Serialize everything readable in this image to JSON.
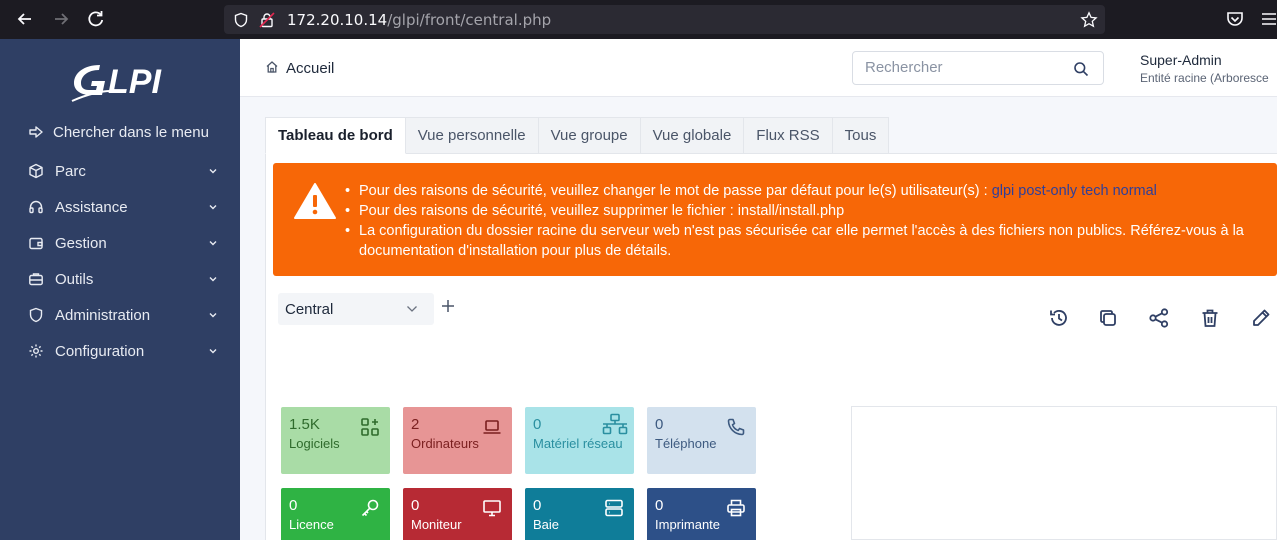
{
  "browser": {
    "url_host": "172.20.10.14",
    "url_path": "/glpi/front/central.php"
  },
  "sidebar": {
    "logo_text": "GLPI",
    "items": [
      {
        "label": "Chercher dans le menu",
        "icon": "arrow-right-icon"
      },
      {
        "label": "Parc",
        "icon": "cube-icon"
      },
      {
        "label": "Assistance",
        "icon": "headset-icon"
      },
      {
        "label": "Gestion",
        "icon": "wallet-icon"
      },
      {
        "label": "Outils",
        "icon": "briefcase-icon"
      },
      {
        "label": "Administration",
        "icon": "shield-icon"
      },
      {
        "label": "Configuration",
        "icon": "gear-icon"
      }
    ]
  },
  "header": {
    "breadcrumb": "Accueil",
    "search_placeholder": "Rechercher",
    "user_name": "Super-Admin",
    "user_entity": "Entité racine (Arboresce"
  },
  "tabs": [
    {
      "label": "Tableau de bord",
      "active": true
    },
    {
      "label": "Vue personnelle",
      "active": false
    },
    {
      "label": "Vue groupe",
      "active": false
    },
    {
      "label": "Vue globale",
      "active": false
    },
    {
      "label": "Flux RSS",
      "active": false
    },
    {
      "label": "Tous",
      "active": false
    }
  ],
  "alert": {
    "color": "#f76707",
    "line1_text": "Pour des raisons de sécurité, veuillez changer le mot de passe par défaut pour le(s) utilisateur(s) : ",
    "line1_link": "glpi post-only tech normal",
    "line2": "Pour des raisons de sécurité, veuillez supprimer le fichier : install/install.php",
    "line3": "La configuration du dossier racine du serveur web n'est pas sécurisée car elle permet l'accès à des fichiers non publics. Référez-vous à la documentation d'installation pour plus de détails."
  },
  "dashboard": {
    "selected": "Central"
  },
  "cards": [
    {
      "value": "1.5K",
      "label": "Logiciels",
      "icon": "apps-icon",
      "bg": "#a9dca6",
      "fg": "#2f6b2c"
    },
    {
      "value": "2",
      "label": "Ordinateurs",
      "icon": "laptop-icon",
      "bg": "#e79595",
      "fg": "#7a1f1f"
    },
    {
      "value": "0",
      "label": "Matériel réseau",
      "icon": "network-icon",
      "bg": "#a9e3e8",
      "fg": "#2a8fa0"
    },
    {
      "value": "0",
      "label": "Téléphone",
      "icon": "phone-icon",
      "bg": "#d3e1ee",
      "fg": "#3d5a80"
    },
    {
      "value": "0",
      "label": "Licence",
      "icon": "key-icon",
      "bg": "#2fb344",
      "fg": "#ffffff"
    },
    {
      "value": "0",
      "label": "Moniteur",
      "icon": "monitor-icon",
      "bg": "#b72a34",
      "fg": "#ffffff"
    },
    {
      "value": "0",
      "label": "Baie",
      "icon": "server-icon",
      "bg": "#0f7d99",
      "fg": "#ffffff"
    },
    {
      "value": "0",
      "label": "Imprimante",
      "icon": "printer-icon",
      "bg": "#2d5088",
      "fg": "#ffffff"
    }
  ]
}
